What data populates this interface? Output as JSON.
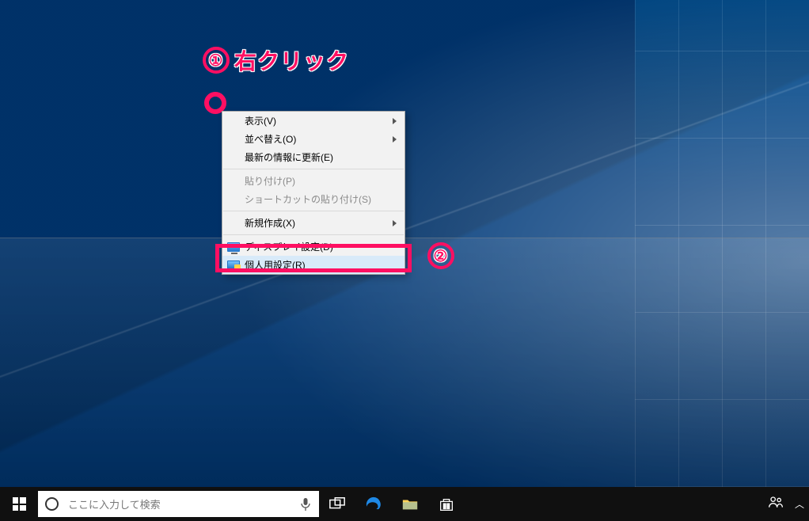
{
  "annotations": {
    "step1_number": "①",
    "step1_label": "右クリック",
    "step2_number": "②"
  },
  "context_menu": {
    "view": "表示(V)",
    "sort": "並べ替え(O)",
    "refresh": "最新の情報に更新(E)",
    "paste": "貼り付け(P)",
    "paste_shortcut": "ショートカットの貼り付け(S)",
    "new": "新規作成(X)",
    "display_settings": "ディスプレイ設定(D)",
    "personalize": "個人用設定(R)"
  },
  "taskbar": {
    "search_placeholder": "ここに入力して検索"
  },
  "colors": {
    "annotation": "#ff0f62"
  }
}
